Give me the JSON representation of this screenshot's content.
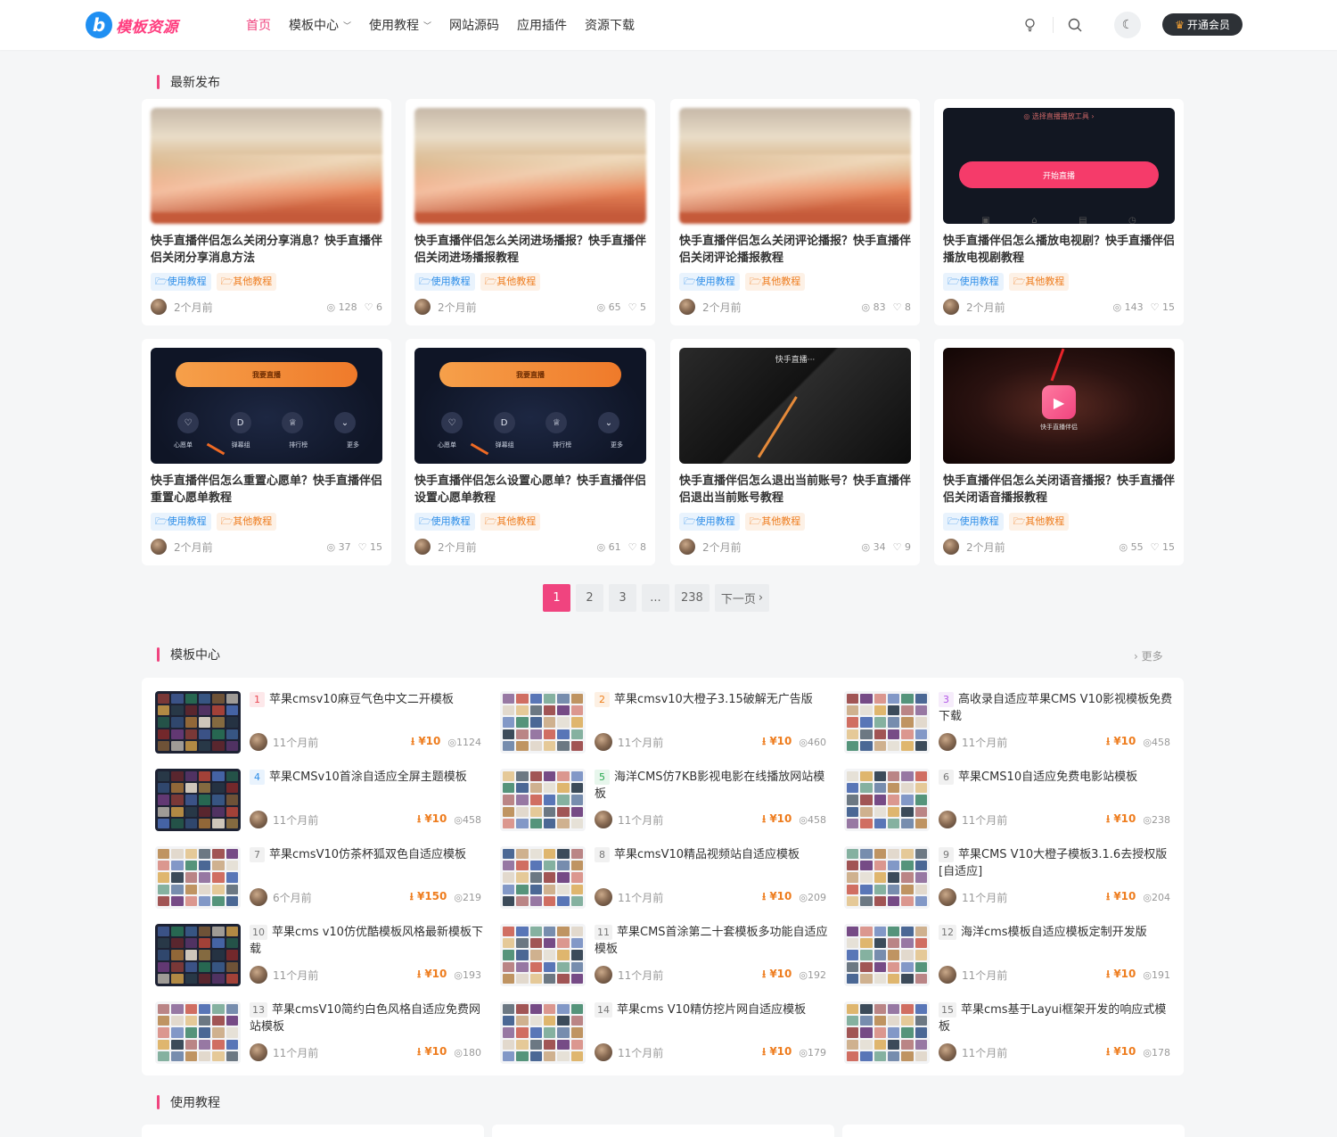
{
  "header": {
    "logo_mark": "b",
    "logo_text": "模板资源",
    "nav": [
      {
        "label": "首页",
        "active": true,
        "dropdown": false
      },
      {
        "label": "模板中心",
        "active": false,
        "dropdown": true
      },
      {
        "label": "使用教程",
        "active": false,
        "dropdown": true
      },
      {
        "label": "网站源码",
        "active": false,
        "dropdown": false
      },
      {
        "label": "应用插件",
        "active": false,
        "dropdown": false
      },
      {
        "label": "资源下载",
        "active": false,
        "dropdown": false
      }
    ],
    "vip_label": "开通会员",
    "icons": [
      "bulb-icon",
      "search-icon",
      "moon-icon",
      "crown-icon"
    ]
  },
  "latest": {
    "section_title": "最新发布",
    "cards": [
      {
        "title": "快手直播伴侣怎么关闭分享消息？快手直播伴侣关闭分享消息方法",
        "tags": [
          "使用教程",
          "其他教程"
        ],
        "time": "2个月前",
        "views": "128",
        "likes": "6",
        "thumb": "blur"
      },
      {
        "title": "快手直播伴侣怎么关闭进场播报？快手直播伴侣关闭进场播报教程",
        "tags": [
          "使用教程",
          "其他教程"
        ],
        "time": "2个月前",
        "views": "65",
        "likes": "5",
        "thumb": "blur"
      },
      {
        "title": "快手直播伴侣怎么关闭评论播报？快手直播伴侣关闭评论播报教程",
        "tags": [
          "使用教程",
          "其他教程"
        ],
        "time": "2个月前",
        "views": "83",
        "likes": "8",
        "thumb": "blur"
      },
      {
        "title": "快手直播伴侣怎么播放电视剧？快手直播伴侣播放电视剧教程",
        "tags": [
          "使用教程",
          "其他教程"
        ],
        "time": "2个月前",
        "views": "143",
        "likes": "15",
        "thumb": "dark1"
      },
      {
        "title": "快手直播伴侣怎么重置心愿单？快手直播伴侣重置心愿单教程",
        "tags": [
          "使用教程",
          "其他教程"
        ],
        "time": "2个月前",
        "views": "37",
        "likes": "15",
        "thumb": "dark2"
      },
      {
        "title": "快手直播伴侣怎么设置心愿单？快手直播伴侣设置心愿单教程",
        "tags": [
          "使用教程",
          "其他教程"
        ],
        "time": "2个月前",
        "views": "61",
        "likes": "8",
        "thumb": "dark2"
      },
      {
        "title": "快手直播伴侣怎么退出当前账号？快手直播伴侣退出当前账号教程",
        "tags": [
          "使用教程",
          "其他教程"
        ],
        "time": "2个月前",
        "views": "34",
        "likes": "9",
        "thumb": "dark3"
      },
      {
        "title": "快手直播伴侣怎么关闭语音播报？快手直播伴侣关闭语音播报教程",
        "tags": [
          "使用教程",
          "其他教程"
        ],
        "time": "2个月前",
        "views": "55",
        "likes": "15",
        "thumb": "dark4"
      }
    ]
  },
  "pagination": {
    "pages": [
      "1",
      "2",
      "3",
      "...",
      "238"
    ],
    "current": "1",
    "next_label": "下一页"
  },
  "templates": {
    "section_title": "模板中心",
    "more_label": "更多",
    "items": [
      {
        "rank": "1",
        "title": "苹果cmsv10麻豆气色中文二开模板",
        "time": "11个月前",
        "price": "¥10",
        "views": "1124",
        "style": "dark"
      },
      {
        "rank": "2",
        "title": "苹果cmsv10大橙子3.15破解无广告版",
        "time": "11个月前",
        "price": "¥10",
        "views": "460",
        "style": "light"
      },
      {
        "rank": "3",
        "title": "高收录自适应苹果CMS V10影视模板免费下载",
        "time": "11个月前",
        "price": "¥10",
        "views": "458",
        "style": "light"
      },
      {
        "rank": "4",
        "title": "苹果CMSv10首涂自适应全屏主题模板",
        "time": "11个月前",
        "price": "¥10",
        "views": "458",
        "style": "dark"
      },
      {
        "rank": "5",
        "title": "海洋CMS仿7KB影视电影在线播放网站模板",
        "time": "11个月前",
        "price": "¥10",
        "views": "458",
        "style": "light"
      },
      {
        "rank": "6",
        "title": "苹果CMS10自适应免费电影站模板",
        "time": "11个月前",
        "price": "¥10",
        "views": "238",
        "style": "light"
      },
      {
        "rank": "7",
        "title": "苹果cmsV10仿茶杯狐双色自适应模板",
        "time": "6个月前",
        "price": "¥150",
        "views": "219",
        "style": "light"
      },
      {
        "rank": "8",
        "title": "苹果cmsV10精品视频站自适应模板",
        "time": "11个月前",
        "price": "¥10",
        "views": "209",
        "style": "light"
      },
      {
        "rank": "9",
        "title": "苹果CMS V10大橙子模板3.1.6去授权版[自适应]",
        "time": "11个月前",
        "price": "¥10",
        "views": "204",
        "style": "light"
      },
      {
        "rank": "10",
        "title": "苹果cms v10仿优酷模板风格最新模板下载",
        "time": "11个月前",
        "price": "¥10",
        "views": "193",
        "style": "dark"
      },
      {
        "rank": "11",
        "title": "苹果CMS首涂第二十套模板多功能自适应模板",
        "time": "11个月前",
        "price": "¥10",
        "views": "192",
        "style": "light"
      },
      {
        "rank": "12",
        "title": "海洋cms模板自适应模板定制开发版",
        "time": "11个月前",
        "price": "¥10",
        "views": "191",
        "style": "light"
      },
      {
        "rank": "13",
        "title": "苹果cmsV10简约白色风格自适应免费网站模板",
        "time": "11个月前",
        "price": "¥10",
        "views": "180",
        "style": "light"
      },
      {
        "rank": "14",
        "title": "苹果cms V10精仿挖片网自适应模板",
        "time": "11个月前",
        "price": "¥10",
        "views": "179",
        "style": "light"
      },
      {
        "rank": "15",
        "title": "苹果cms基于Layui框架开发的响应式模板",
        "time": "11个月前",
        "price": "¥10",
        "views": "178",
        "style": "light"
      }
    ]
  },
  "tutorials": {
    "section_title": "使用教程"
  },
  "colors": {
    "accent": "#f0447f",
    "tag_blue": "#2c8de8",
    "tag_orange": "#ee7d1f",
    "vip_bg": "#2d3136"
  }
}
